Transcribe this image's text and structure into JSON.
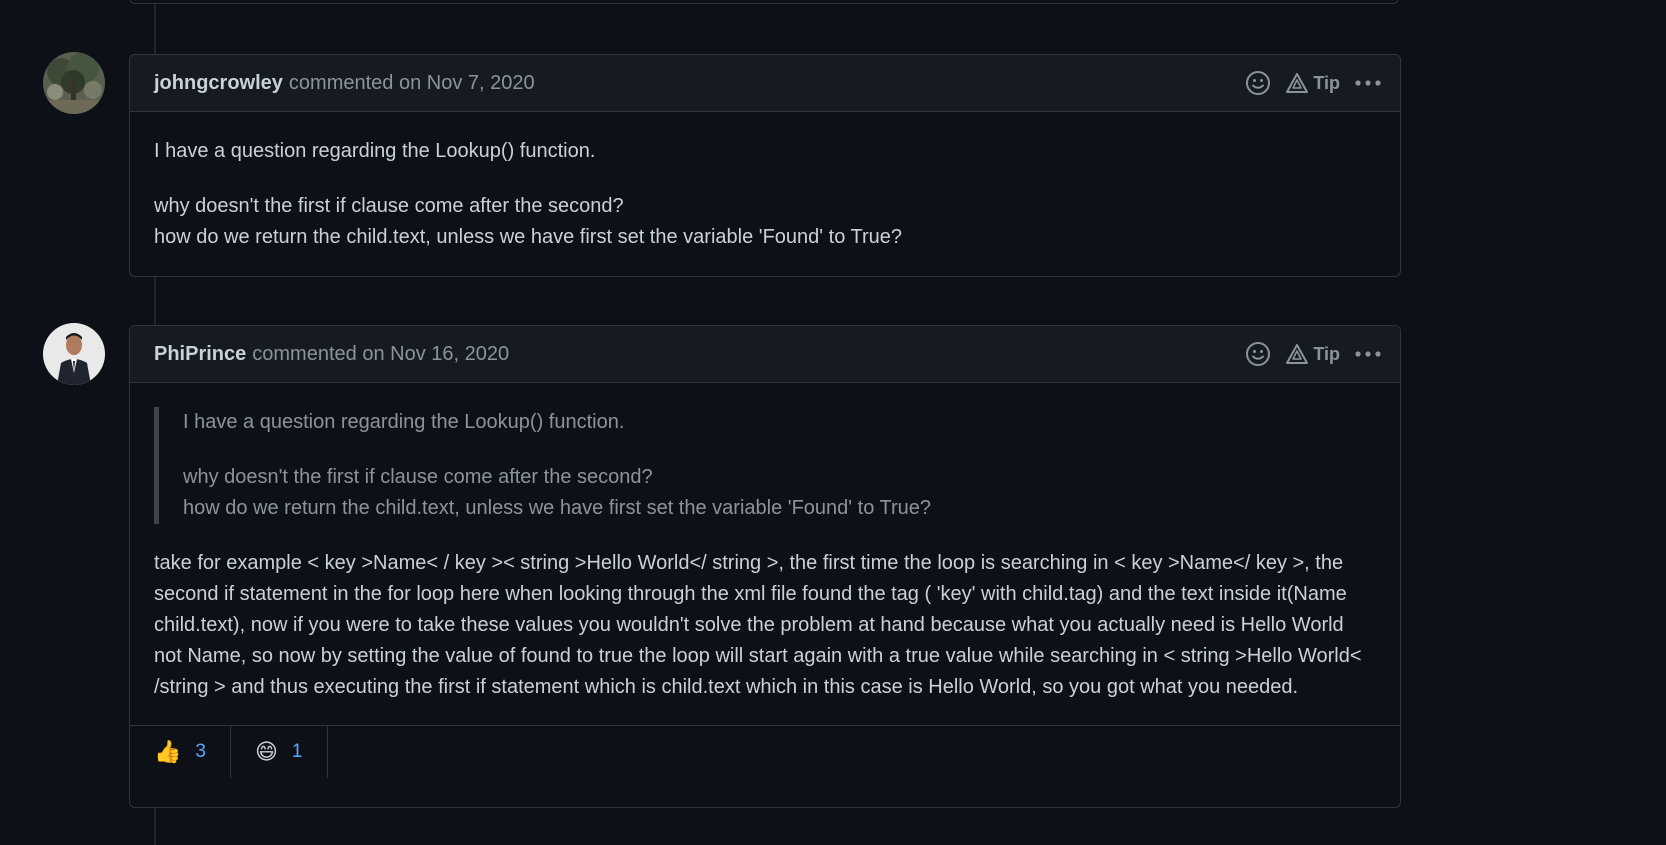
{
  "comments": [
    {
      "author": "johngcrowley",
      "meta_prefix": "commented",
      "date": "on Nov 7, 2020",
      "tip_label": "Tip",
      "body": {
        "p1": "I have a question regarding the Lookup() function.",
        "p2_line1": "why doesn't the first if clause come after the second?",
        "p2_line2": "how do we return the child.text, unless we have first set the variable 'Found' to True?"
      }
    },
    {
      "author": "PhiPrince",
      "meta_prefix": "commented",
      "date": "on Nov 16, 2020",
      "tip_label": "Tip",
      "quote": {
        "p1": "I have a question regarding the Lookup() function.",
        "p2_line1": "why doesn't the first if clause come after the second?",
        "p2_line2": "how do we return the child.text, unless we have first set the variable 'Found' to True?"
      },
      "body": {
        "p1": "take for example < key >Name< / key >< string >Hello World</ string >, the first time the loop is searching in < key >Name</ key >, the second if statement in the for loop here when looking through the xml file found the tag ( 'key' with child.tag) and the text inside it(Name child.text), now if you were to take these values you wouldn't solve the problem at hand because what you actually need is Hello World not Name, so now by setting the value of found to true the loop will start again with a true value while searching in < string >Hello World< /string > and thus executing the first if statement which is child.text which in this case is Hello World, so you got what you needed."
      },
      "reactions": [
        {
          "emoji": "👍",
          "icon": "thumbs-up-icon",
          "count": "3"
        },
        {
          "emoji": "😄",
          "icon": "smile-icon",
          "count": "1"
        }
      ]
    }
  ],
  "colors": {
    "background": "#0d1117",
    "header_bg": "#161b22",
    "border": "#30363d",
    "text": "#c9d1d9",
    "muted": "#8b949e",
    "link": "#58a6ff"
  }
}
